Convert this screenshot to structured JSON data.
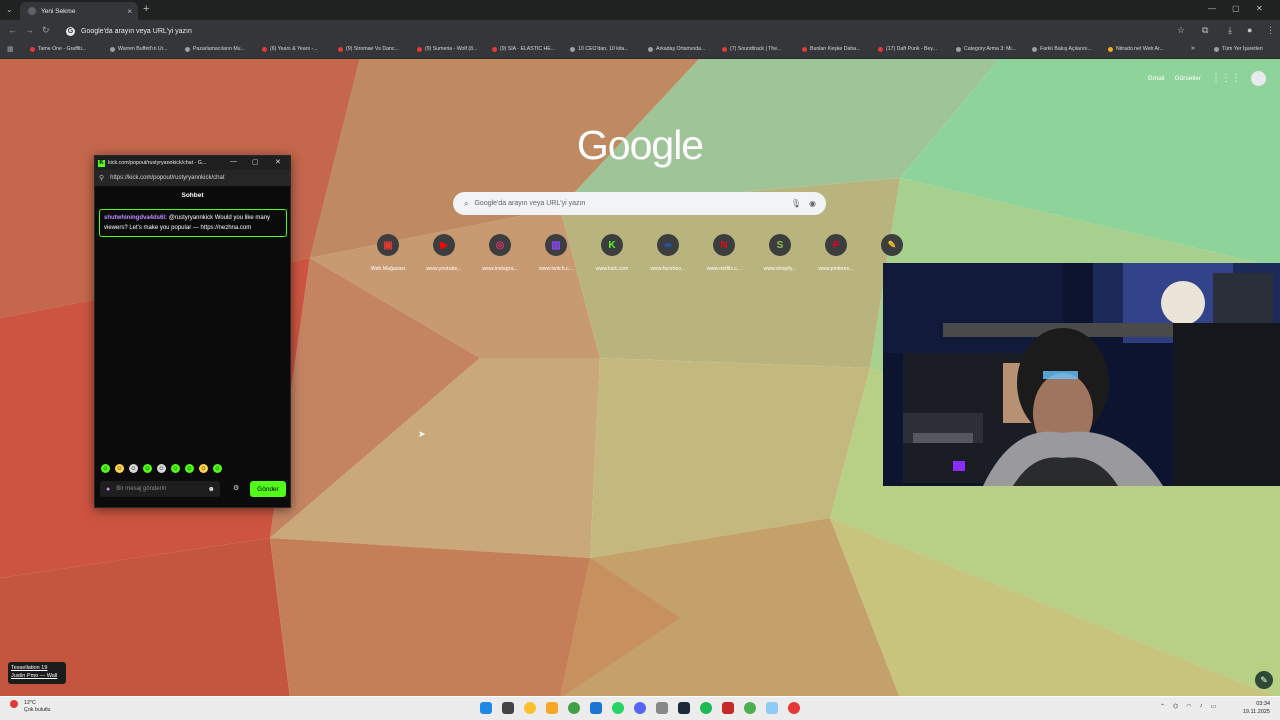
{
  "browser": {
    "active_tab_title": "Yeni Sekme",
    "omnibox_text": "Google'da arayın veya URL'yi yazın"
  },
  "bookmarks": [
    {
      "label": "Tame One - Graffiti...",
      "color": "red"
    },
    {
      "label": "Warren Buffett'ın Ur...",
      "color": "gray"
    },
    {
      "label": "Pazarlamacıların Mu...",
      "color": "gray"
    },
    {
      "label": "(6) Years & Years -...",
      "color": "red"
    },
    {
      "label": "(9) Stromae Vs Danc...",
      "color": "red"
    },
    {
      "label": "(9) Sumeria - Wolf (8...",
      "color": "red"
    },
    {
      "label": "(9) SIA - ELASTIC HE...",
      "color": "red"
    },
    {
      "label": "10 CEO'dan, 10 kita...",
      "color": "gray"
    },
    {
      "label": "Arkadaş Ortamında...",
      "color": "gray"
    },
    {
      "label": "(7) Soundtrack | The...",
      "color": "red"
    },
    {
      "label": "Bunları Keşke Daha...",
      "color": "red"
    },
    {
      "label": "(17) Daft Punk - Bey...",
      "color": "red"
    },
    {
      "label": "Category:Arma 3: Mi...",
      "color": "gray"
    },
    {
      "label": "Farklı Bakış Açılarını...",
      "color": "gray"
    },
    {
      "label": "Nitrado.net Web Ar...",
      "color": "yellow"
    },
    {
      "label": "Tüm Yer İşaretleri",
      "color": "gray"
    }
  ],
  "ntp": {
    "logo": "Google",
    "gmail": "Gmail",
    "images": "Görseller",
    "search_placeholder": "Google'da arayın veya URL'yi yazın",
    "shortcuts": [
      {
        "label": "Web Mağazası",
        "glyph": "▣",
        "bg": "#3b3d3f",
        "fg": "#e53935"
      },
      {
        "label": "www.youtube...",
        "glyph": "▶",
        "bg": "#3b3d3f",
        "fg": "#ff0000"
      },
      {
        "label": "www.instagra...",
        "glyph": "◎",
        "bg": "#3b3d3f",
        "fg": "#e1306c"
      },
      {
        "label": "www.twitch.c...",
        "glyph": "▥",
        "bg": "#3b3d3f",
        "fg": "#9146ff"
      },
      {
        "label": "www.kick.com",
        "glyph": "K",
        "bg": "#3b3d3f",
        "fg": "#53fc18"
      },
      {
        "label": "www.faceboo...",
        "glyph": "∞",
        "bg": "#3b3d3f",
        "fg": "#0866ff"
      },
      {
        "label": "www.netflix.c...",
        "glyph": "N",
        "bg": "#3b3d3f",
        "fg": "#e50914"
      },
      {
        "label": "www.shopify...",
        "glyph": "S",
        "bg": "#3b3d3f",
        "fg": "#95bf47"
      },
      {
        "label": "www.pinteres...",
        "glyph": "P",
        "bg": "#3b3d3f",
        "fg": "#e60023"
      },
      {
        "label": "",
        "glyph": "✎",
        "bg": "#3b3d3f",
        "fg": "#fbc02d"
      }
    ]
  },
  "chat_popout": {
    "window_title": "kick.com/popout/rustyryannkick/chat - G...",
    "url": "https://kick.com/popout/rustyryannkick/chat",
    "heading": "Sohbet",
    "message_user": "shutwhiningdva4ds6l:",
    "message_text": "@rustyryannkick Would you like many viewers? Let's make you popular — https://nezhna.com",
    "input_placeholder": "Bir mesaj gönderin",
    "send_label": "Gönder"
  },
  "notification": {
    "line1": "Tessellation 19",
    "line2": "Justin Pmo — Wall"
  },
  "taskbar": {
    "weather_temp": "12°C",
    "weather_desc": "Çok bulutlu",
    "time": "03:34",
    "date": "19.11.2025"
  }
}
